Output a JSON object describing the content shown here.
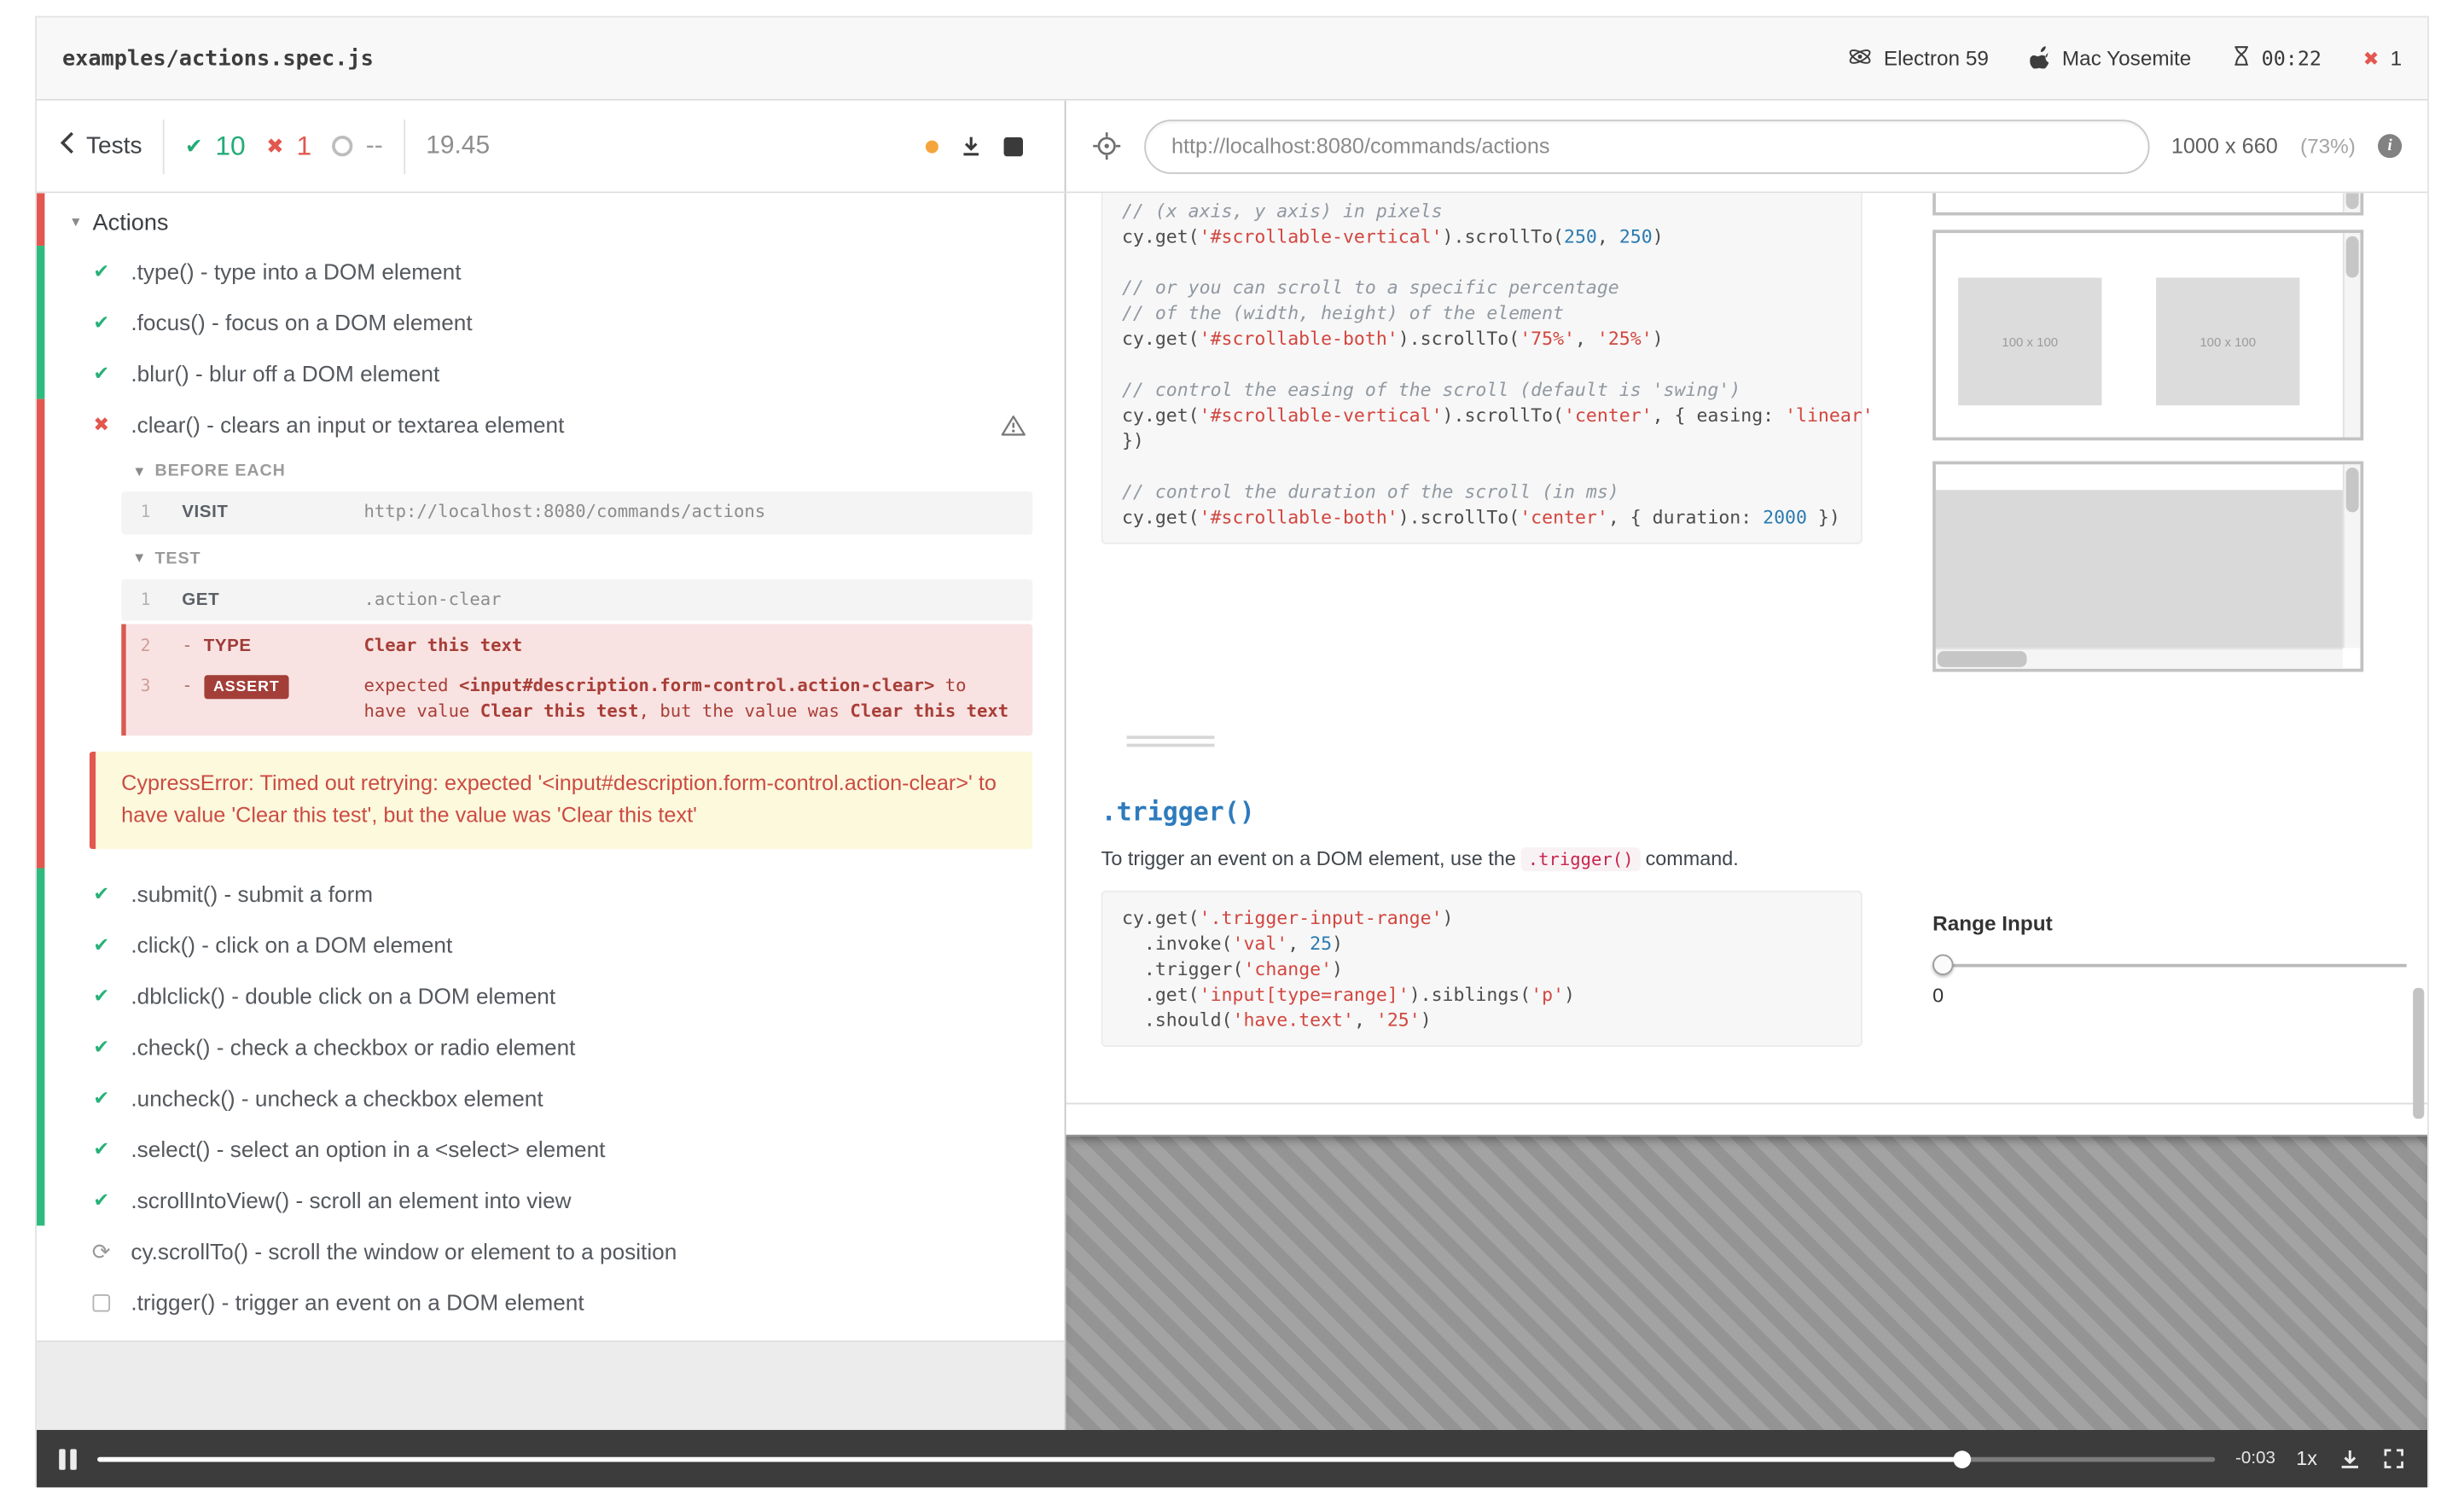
{
  "header": {
    "spec": "examples/actions.spec.js",
    "browser": "Electron 59",
    "os": "Mac Yosemite",
    "timer": "00:22",
    "failures": "1"
  },
  "toolbar": {
    "back": "Tests",
    "passed": "10",
    "failed": "1",
    "pending": "--",
    "duration": "19.45",
    "url": "http://localhost:8080/commands/actions",
    "viewport": "1000 x 660",
    "scale": "(73%)"
  },
  "icons": {
    "check": "✔",
    "cross": "✖",
    "caret_down": "▾",
    "spinner": "⟳",
    "info": "i"
  },
  "colors": {
    "passed": "#28b179",
    "failed": "#e2574f",
    "pending": "#9b9b9b",
    "alert_dot": "#f5a53b",
    "link": "#2e7bbd"
  },
  "log": {
    "suite": "Actions",
    "top_tests": [
      ".type() - type into a DOM element",
      ".focus() - focus on a DOM element",
      ".blur() - blur off a DOM element"
    ],
    "failed": {
      "title": ".clear() - clears an input or textarea element",
      "before_each_label": "BEFORE EACH",
      "test_label": "TEST",
      "dash": "-",
      "visit": {
        "n": "1",
        "name": "VISIT",
        "msg": "http://localhost:8080/commands/actions"
      },
      "get": {
        "n": "1",
        "name": "GET",
        "msg": ".action-clear"
      },
      "type": {
        "n": "2",
        "name": "TYPE",
        "msg": "Clear this text"
      },
      "assert": {
        "n": "3",
        "name": "ASSERT",
        "m1": "expected ",
        "m2": "<input#description.form-control.action-clear>",
        "m3": " to have value ",
        "m4": "Clear this test",
        "m5": ", but the value was ",
        "m6": "Clear this text"
      },
      "error": "CypressError: Timed out retrying: expected '<input#description.form-control.action-clear>' to have value 'Clear this test', but the value was 'Clear this text'"
    },
    "bottom_tests": [
      ".submit() - submit a form",
      ".click() - click on a DOM element",
      ".dblclick() - double click on a DOM element",
      ".check() - check a checkbox or radio element",
      ".uncheck() - uncheck a checkbox element",
      ".select() - select an option in a <select> element",
      ".scrollIntoView() - scroll an element into view"
    ],
    "running_test": "cy.scrollTo() - scroll the window or element to a position",
    "pending_test": ".trigger() - trigger an event on a DOM element"
  },
  "aut": {
    "code1": [
      [
        {
          "c": "cm",
          "t": "// (x axis, y axis) in pixels"
        }
      ],
      [
        {
          "t": "cy.get("
        },
        {
          "c": "st",
          "t": "'#scrollable-vertical'"
        },
        {
          "t": ").scrollTo("
        },
        {
          "c": "nu",
          "t": "250"
        },
        {
          "t": ", "
        },
        {
          "c": "nu",
          "t": "250"
        },
        {
          "t": ")"
        }
      ],
      [],
      [
        {
          "c": "cm",
          "t": "// or you can scroll to a specific percentage"
        }
      ],
      [
        {
          "c": "cm",
          "t": "// of the (width, height) of the element"
        }
      ],
      [
        {
          "t": "cy.get("
        },
        {
          "c": "st",
          "t": "'#scrollable-both'"
        },
        {
          "t": ").scrollTo("
        },
        {
          "c": "st",
          "t": "'75%'"
        },
        {
          "t": ", "
        },
        {
          "c": "st",
          "t": "'25%'"
        },
        {
          "t": ")"
        }
      ],
      [],
      [
        {
          "c": "cm",
          "t": "// control the easing of the scroll (default is 'swing')"
        }
      ],
      [
        {
          "t": "cy.get("
        },
        {
          "c": "st",
          "t": "'#scrollable-vertical'"
        },
        {
          "t": ").scrollTo("
        },
        {
          "c": "st",
          "t": "'center'"
        },
        {
          "t": ", { easing: "
        },
        {
          "c": "st",
          "t": "'linear'"
        }
      ],
      [
        {
          "t": "})"
        }
      ],
      [],
      [
        {
          "c": "cm",
          "t": "// control the duration of the scroll (in ms)"
        }
      ],
      [
        {
          "t": "cy.get("
        },
        {
          "c": "st",
          "t": "'#scrollable-both'"
        },
        {
          "t": ").scrollTo("
        },
        {
          "c": "st",
          "t": "'center'"
        },
        {
          "t": ", { duration: "
        },
        {
          "c": "nu",
          "t": "2000"
        },
        {
          "t": " })"
        }
      ]
    ],
    "box_label": "100 x 100",
    "trigger_heading": ".trigger()",
    "trigger_desc_1": "To trigger an event on a DOM element, use the ",
    "trigger_desc_code": ".trigger()",
    "trigger_desc_2": " command.",
    "code2": [
      [
        {
          "t": "cy.get("
        },
        {
          "c": "st",
          "t": "'.trigger-input-range'"
        },
        {
          "t": ")"
        }
      ],
      [
        {
          "t": "  .invoke("
        },
        {
          "c": "st",
          "t": "'val'"
        },
        {
          "t": ", "
        },
        {
          "c": "nu",
          "t": "25"
        },
        {
          "t": ")"
        }
      ],
      [
        {
          "t": "  .trigger("
        },
        {
          "c": "st",
          "t": "'change'"
        },
        {
          "t": ")"
        }
      ],
      [
        {
          "t": "  .get("
        },
        {
          "c": "st",
          "t": "'input[type=range]'"
        },
        {
          "t": ").siblings("
        },
        {
          "c": "st",
          "t": "'p'"
        },
        {
          "t": ")"
        }
      ],
      [
        {
          "t": "  .should("
        },
        {
          "c": "st",
          "t": "'have.text'"
        },
        {
          "t": ", "
        },
        {
          "c": "st",
          "t": "'25'"
        },
        {
          "t": ")"
        }
      ]
    ],
    "range_label": "Range Input",
    "range_value": "0"
  },
  "player": {
    "time": "-0:03",
    "rate": "1x",
    "progress_percent": 88
  }
}
